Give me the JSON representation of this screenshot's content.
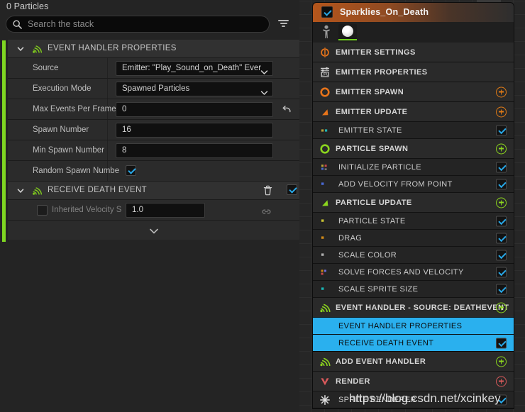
{
  "left_panel": {
    "particles_count": "0 Particles",
    "search": {
      "placeholder": "Search the stack",
      "icon": "search-icon"
    },
    "filter_icon": "filter-icon",
    "sections": [
      {
        "type": "header",
        "label": "EVENT HANDLER PROPERTIES",
        "icon": "event-handler-icon",
        "expanded": true
      },
      {
        "type": "combo",
        "label": "Source",
        "value": "Emitter: \"Play_Sound_on_Death\" Ever"
      },
      {
        "type": "combo",
        "label": "Execution Mode",
        "value": "Spawned Particles"
      },
      {
        "type": "text",
        "label": "Max Events Per Frame",
        "value": "0",
        "has_revert": true
      },
      {
        "type": "text",
        "label": "Spawn Number",
        "value": "16"
      },
      {
        "type": "text",
        "label": "Min Spawn Number",
        "value": "8"
      },
      {
        "type": "checkbox",
        "label": "Random Spawn Numbe",
        "checked": true
      },
      {
        "type": "header",
        "label": "RECEIVE DEATH EVENT",
        "icon": "event-handler-icon",
        "expanded": true,
        "has_trash": true,
        "checked": true
      },
      {
        "type": "text_with_checkbox",
        "label": "Inherited Velocity S",
        "value": "1.0",
        "checked": false,
        "has_link": true
      }
    ]
  },
  "node": {
    "title": "Sparklies_On_Death",
    "enabled": true,
    "thumbnails": [
      "person-icon",
      "sphere-preview"
    ],
    "rows": [
      {
        "label": "EMITTER SETTINGS",
        "kind": "stage",
        "icon": "emitter-settings-icon",
        "accent": "#e07b16",
        "control": "none"
      },
      {
        "label": "EMITTER PROPERTIES",
        "kind": "stage",
        "icon": "cpu-icon",
        "accent": "#cfcfcf",
        "control": "none"
      },
      {
        "label": "EMITTER SPAWN",
        "kind": "stage",
        "icon": "spawn-ring-icon",
        "accent": "#e07b16",
        "control": "plus-orange"
      },
      {
        "label": "EMITTER UPDATE",
        "kind": "stage",
        "icon": "update-arrow-icon",
        "accent": "#e07b16",
        "control": "plus-orange"
      },
      {
        "label": "EMITTER STATE",
        "kind": "module",
        "icon": "module-dots-icon",
        "accent": "#b9a43a",
        "control": "checkbox",
        "checked": true
      },
      {
        "label": "PARTICLE SPAWN",
        "kind": "stage",
        "icon": "spawn-ring-icon",
        "accent": "#8cd61e",
        "control": "plus-green"
      },
      {
        "label": "INITIALIZE PARTICLE",
        "kind": "module",
        "icon": "module-dots-icon",
        "accent": "#b9a43a",
        "control": "checkbox",
        "checked": true
      },
      {
        "label": "ADD VELOCITY FROM POINT",
        "kind": "module",
        "icon": "module-dot-icon",
        "accent": "#4a69d4",
        "control": "checkbox",
        "checked": true
      },
      {
        "label": "PARTICLE UPDATE",
        "kind": "stage",
        "icon": "update-arrow-icon",
        "accent": "#8cd61e",
        "control": "plus-green"
      },
      {
        "label": "PARTICLE STATE",
        "kind": "module",
        "icon": "module-dot-icon",
        "accent": "#c8c232",
        "control": "checkbox",
        "checked": true
      },
      {
        "label": "DRAG",
        "kind": "module",
        "icon": "module-dot-icon",
        "accent": "#d08a18",
        "control": "checkbox",
        "checked": true
      },
      {
        "label": "SCALE COLOR",
        "kind": "module",
        "icon": "module-dot-icon",
        "accent": "#b0b0b0",
        "control": "checkbox",
        "checked": true
      },
      {
        "label": "SOLVE FORCES AND VELOCITY",
        "kind": "module",
        "icon": "module-dots-icon",
        "accent": "#d08a18",
        "control": "checkbox",
        "checked": true
      },
      {
        "label": "SCALE SPRITE SIZE",
        "kind": "module",
        "icon": "module-dot-icon",
        "accent": "#19b6b6",
        "control": "checkbox",
        "checked": true
      },
      {
        "label": "EVENT HANDLER - SOURCE: DEATHEVENT",
        "kind": "stage",
        "icon": "event-handler-icon",
        "accent": "#8cd61e",
        "control": "plus-green"
      },
      {
        "label": "EVENT HANDLER PROPERTIES",
        "kind": "module",
        "icon": "none",
        "accent": "#8cd61e",
        "control": "none",
        "selected": true
      },
      {
        "label": "RECEIVE DEATH EVENT",
        "kind": "module",
        "icon": "none",
        "accent": "#8cd61e",
        "control": "checkbox",
        "checked": true,
        "selected": true
      },
      {
        "label": "ADD EVENT HANDLER",
        "kind": "stage",
        "icon": "event-handler-icon",
        "accent": "#8cd61e",
        "control": "plus-green"
      },
      {
        "label": "RENDER",
        "kind": "stage",
        "icon": "render-icon",
        "accent": "#d9595b",
        "control": "plus-red"
      },
      {
        "label": "SPRITE RENDERER",
        "kind": "module",
        "icon": "sprite-renderer-icon",
        "accent": "#dddddd",
        "control": "checkbox",
        "checked": true
      }
    ]
  },
  "watermark": {
    "text": "https://blog.csdn.net/xcinkey"
  },
  "colors": {
    "selection_blue": "#2ab0ee",
    "accent_green": "#7fd622",
    "accent_orange": "#e07b16",
    "checkbox_blue": "#28a8e8",
    "panel_bg": "#242424",
    "grid_bg": "#262626"
  }
}
